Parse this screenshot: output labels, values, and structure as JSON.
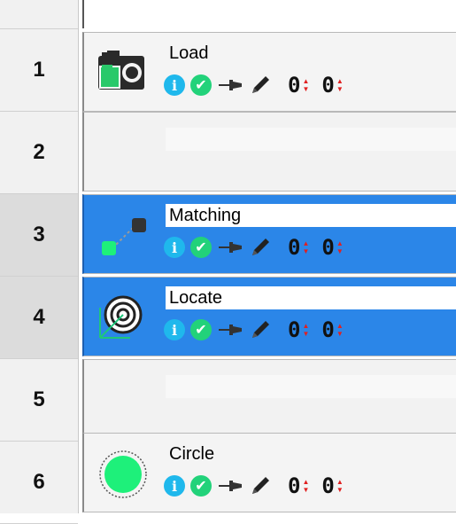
{
  "rows": [
    {
      "number": "1",
      "title": "Load",
      "counter_a": "0",
      "counter_b": "0"
    },
    {
      "number": "2"
    },
    {
      "number": "3",
      "title": "Matching",
      "counter_a": "0",
      "counter_b": "0"
    },
    {
      "number": "4",
      "title": "Locate",
      "counter_a": "0",
      "counter_b": "0"
    },
    {
      "number": "5"
    },
    {
      "number": "6",
      "title": "Circle",
      "counter_a": "0",
      "counter_b": "0"
    }
  ],
  "icons": {
    "thumb_row1": "camera-icon",
    "thumb_row3": "matching-icon",
    "thumb_row4": "target-icon",
    "thumb_row6": "circle-icon",
    "info": "info-icon",
    "check": "check-icon",
    "pin": "pin-icon",
    "edit": "pencil-icon"
  },
  "colors": {
    "selection": "#2b86e8",
    "info": "#1fb8ec",
    "check": "#22d27a",
    "spinner_arrows": "#e02020",
    "circle_fill": "#1ef07a"
  }
}
